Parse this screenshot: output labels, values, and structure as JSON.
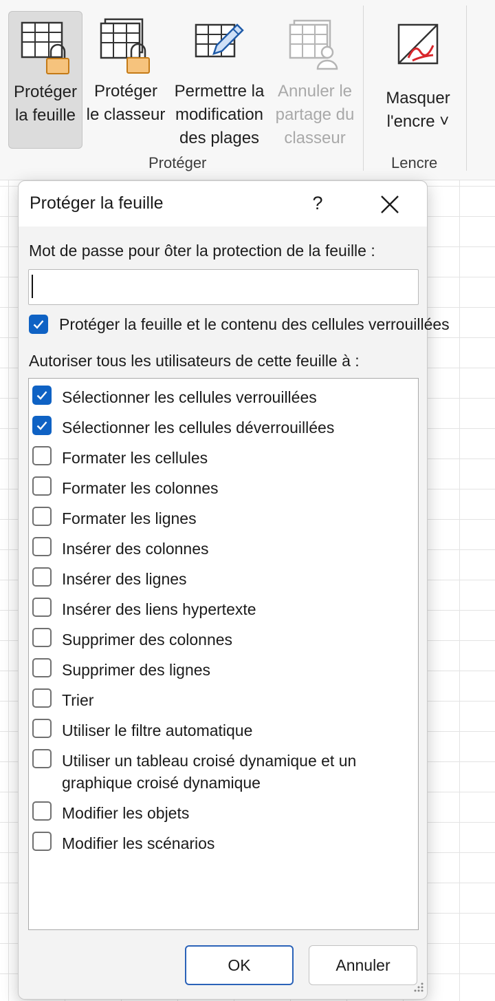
{
  "ribbon": {
    "buttons": [
      {
        "label": "Protéger\nla feuille",
        "icon": "protect-sheet-icon"
      },
      {
        "label": "Protéger\nle classeur",
        "icon": "protect-workbook-icon"
      },
      {
        "label": "Permettre la\nmodification\ndes plages",
        "icon": "allow-edit-ranges-icon"
      },
      {
        "label": "Annuler le\npartage du\nclasseur",
        "icon": "unshare-workbook-icon"
      },
      {
        "label": "Masquer\nl'encre ˅",
        "icon": "hide-ink-icon"
      }
    ],
    "groups": [
      "Protéger",
      "Lencre"
    ]
  },
  "dialog": {
    "title": "Protéger la feuille",
    "help": "?",
    "password_label": "Mot de passe pour ôter la protection de la feuille :",
    "password_value": "",
    "protect_label": "Protéger la feuille et le contenu des cellules verrouillées",
    "protect_checked": true,
    "allow_label": "Autoriser tous les utilisateurs de cette feuille à :",
    "options": [
      {
        "label": "Sélectionner les cellules verrouillées",
        "checked": true
      },
      {
        "label": "Sélectionner les cellules déverrouillées",
        "checked": true
      },
      {
        "label": "Formater les cellules",
        "checked": false
      },
      {
        "label": "Formater les colonnes",
        "checked": false
      },
      {
        "label": "Formater les lignes",
        "checked": false
      },
      {
        "label": "Insérer des colonnes",
        "checked": false
      },
      {
        "label": "Insérer des lignes",
        "checked": false
      },
      {
        "label": "Insérer des liens hypertexte",
        "checked": false
      },
      {
        "label": "Supprimer des colonnes",
        "checked": false
      },
      {
        "label": "Supprimer des lignes",
        "checked": false
      },
      {
        "label": "Trier",
        "checked": false
      },
      {
        "label": "Utiliser le filtre automatique",
        "checked": false
      },
      {
        "label": "Utiliser un tableau croisé dynamique et un\ngraphique croisé dynamique",
        "checked": false
      },
      {
        "label": "Modifier les objets",
        "checked": false
      },
      {
        "label": "Modifier les scénarios",
        "checked": false
      }
    ],
    "ok_label": "OK",
    "cancel_label": "Annuler"
  },
  "colors": {
    "accent": "#0f62c4",
    "ok_border": "#2a62b8",
    "lock": "#f0ad4e",
    "ink": "#d9262b"
  }
}
